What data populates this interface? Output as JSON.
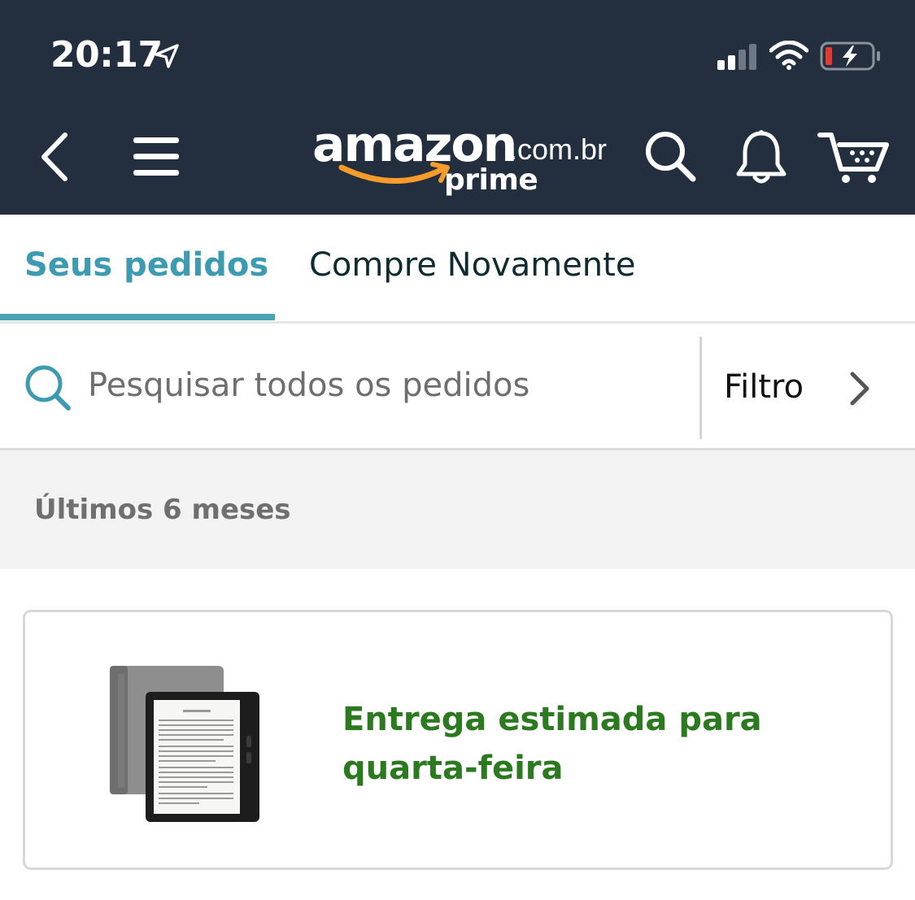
{
  "status_bar": {
    "time": "20:17",
    "icons": [
      "location-arrow-icon",
      "cellular-signal-icon",
      "wifi-icon",
      "battery-charging-icon"
    ]
  },
  "header": {
    "logo": {
      "wordmark": "amazon",
      "domain": ".com.br",
      "subbrand": "prime"
    },
    "icons": [
      "back-icon",
      "menu-icon",
      "search-icon",
      "bell-icon",
      "cart-icon"
    ],
    "colors": {
      "background": "#232f3e",
      "smile": "#f79c2a"
    }
  },
  "tabs": [
    {
      "label": "Seus pedidos",
      "active": true
    },
    {
      "label": "Compre Novamente",
      "active": false
    }
  ],
  "search": {
    "placeholder": "Pesquisar todos os pedidos",
    "value": "",
    "filter_label": "Filtro"
  },
  "section": {
    "title": "Últimos 6 meses"
  },
  "orders": [
    {
      "product_image": "kindle-oasis-image",
      "status": "Entrega estimada para quarta-feira",
      "status_color": "#2c7a1f"
    }
  ],
  "colors": {
    "accent": "#3c9bb0",
    "delivery_green": "#2c7a1f"
  }
}
